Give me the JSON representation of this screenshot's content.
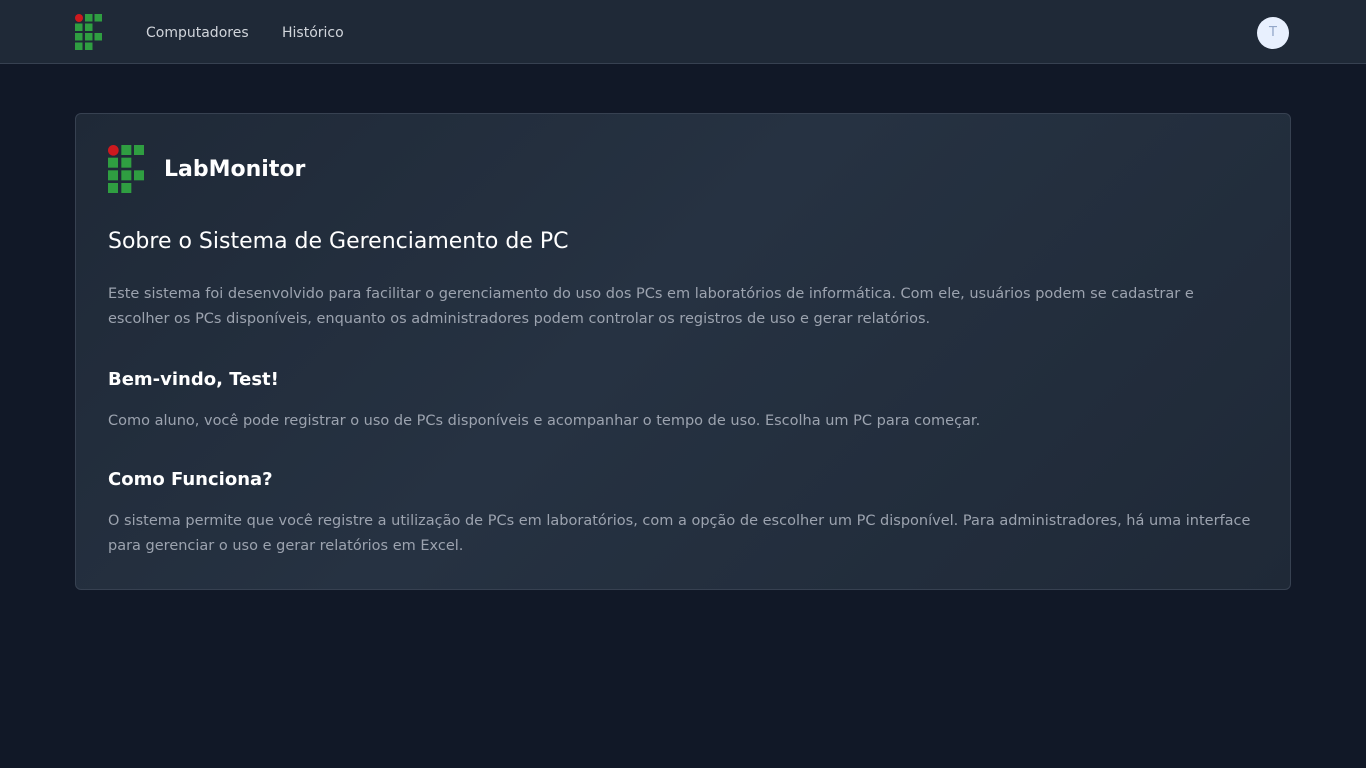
{
  "navbar": {
    "logo_icon": "if-logo-icon",
    "links": [
      {
        "label": "Computadores"
      },
      {
        "label": "Histórico"
      }
    ],
    "avatar_initial": "T"
  },
  "card": {
    "logo_icon": "if-logo-icon",
    "brand_name": "LabMonitor",
    "about_heading": "Sobre o Sistema de Gerenciamento de PC",
    "about_text": "Este sistema foi desenvolvido para facilitar o gerenciamento do uso dos PCs em laboratórios de informática. Com ele, usuários podem se cadastrar e escolher os PCs disponíveis, enquanto os administradores podem controlar os registros de uso e gerar relatórios.",
    "welcome_heading": "Bem-vindo, Test!",
    "welcome_text": "Como aluno, você pode registrar o uso de PCs disponíveis e acompanhar o tempo de uso. Escolha um PC para começar.",
    "how_heading": "Como Funciona?",
    "how_text": "O sistema permite que você registre a utilização de PCs em laboratórios, com a opção de escolher um PC disponível. Para administradores, há uma interface para gerenciar o uso e gerar relatórios em Excel."
  },
  "colors": {
    "background": "#111827",
    "navbar": "#1f2937",
    "logo_green": "#2f9e41",
    "logo_red": "#cd191e"
  }
}
